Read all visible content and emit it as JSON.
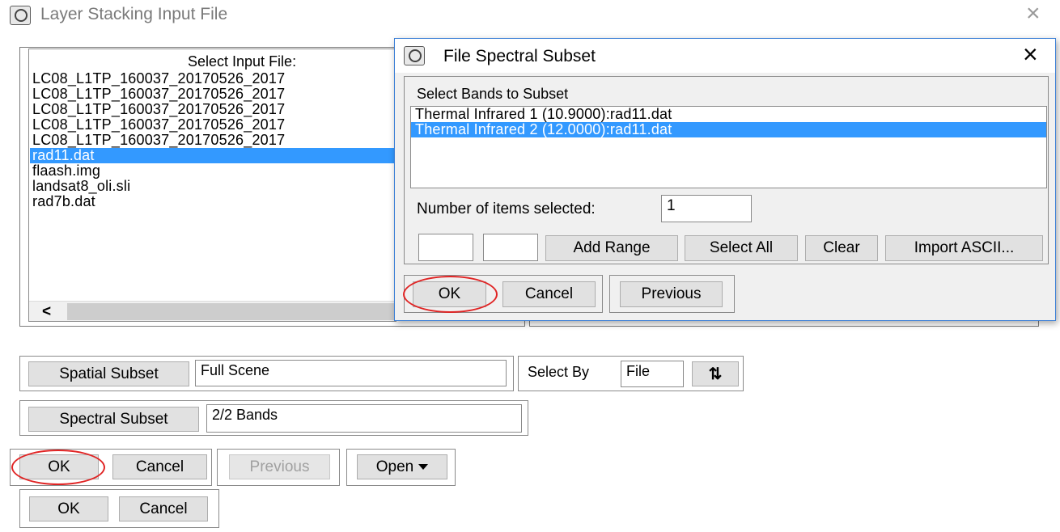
{
  "main_window": {
    "title": "Layer Stacking Input File",
    "close_glyph": "×",
    "select_input_label": "Select Input File:",
    "files": [
      {
        "name": "LC08_L1TP_160037_20170526_2017",
        "selected": false
      },
      {
        "name": "LC08_L1TP_160037_20170526_2017",
        "selected": false
      },
      {
        "name": "LC08_L1TP_160037_20170526_2017",
        "selected": false
      },
      {
        "name": "LC08_L1TP_160037_20170526_2017",
        "selected": false
      },
      {
        "name": "LC08_L1TP_160037_20170526_2017",
        "selected": false
      },
      {
        "name": "rad11.dat",
        "selected": true
      },
      {
        "name": "flaash.img",
        "selected": false
      },
      {
        "name": "landsat8_oli.sli",
        "selected": false
      },
      {
        "name": "rad7b.dat",
        "selected": false
      }
    ],
    "scroll_left_glyph": "<",
    "spatial_subset_label": "Spatial Subset",
    "spatial_subset_value": "Full Scene",
    "select_by_label": "Select By",
    "select_by_value": "File",
    "sort_glyph": "⇅",
    "spectral_subset_label": "Spectral Subset",
    "spectral_subset_value": "2/2 Bands",
    "ok_label": "OK",
    "cancel_label": "Cancel",
    "previous_label": "Previous",
    "open_label": "Open",
    "outer_ok_label": "OK",
    "outer_cancel_label": "Cancel"
  },
  "subset_dialog": {
    "title": "File Spectral Subset",
    "close_glyph": "×",
    "bands_label": "Select Bands to Subset",
    "bands": [
      {
        "name": "Thermal Infrared 1 (10.9000):rad11.dat",
        "selected": false
      },
      {
        "name": "Thermal Infrared 2 (12.0000):rad11.dat",
        "selected": true
      }
    ],
    "count_label": "Number of items selected:",
    "count_value": "1",
    "range_from": "",
    "range_to": "",
    "add_range_label": "Add Range",
    "select_all_label": "Select All",
    "clear_label": "Clear",
    "import_ascii_label": "Import ASCII...",
    "ok_label": "OK",
    "cancel_label": "Cancel",
    "previous_label": "Previous"
  },
  "colors": {
    "selection": "#3399ff",
    "highlight_ring": "#e02424"
  }
}
